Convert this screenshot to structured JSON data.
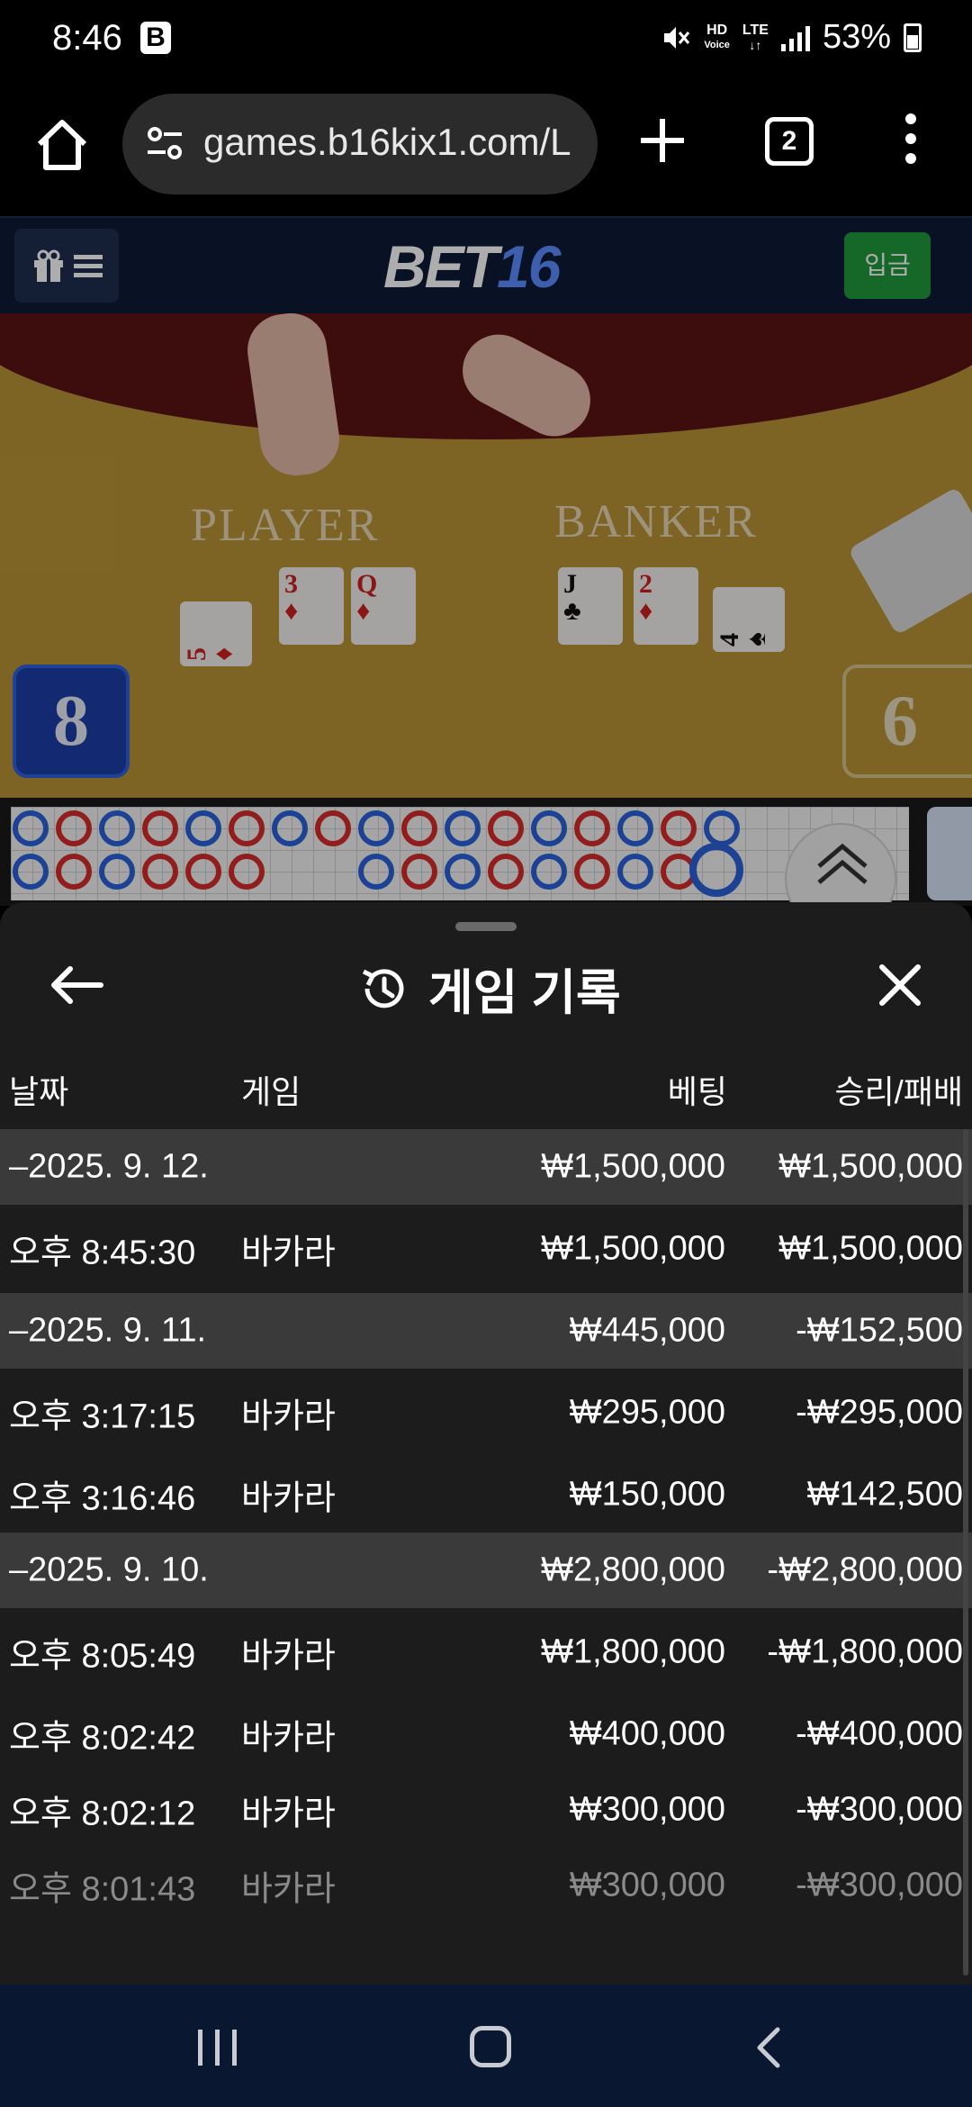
{
  "status_bar": {
    "time": "8:46",
    "app_badge": "B",
    "net_hd": "HD",
    "net_voice": "Voice",
    "net_lte": "LTE",
    "battery": "53%"
  },
  "browser": {
    "url": "games.b16kix1.com/L",
    "tab_count": "2"
  },
  "site": {
    "logo_text": "BET",
    "logo_num": "16",
    "deposit_label": "입금"
  },
  "game_view": {
    "player_label": "PLAYER",
    "banker_label": "BANKER",
    "player_score": "8",
    "banker_score": "6",
    "player_cards": [
      {
        "rank": "5",
        "suit": "♦",
        "color": "red"
      },
      {
        "rank": "3",
        "suit": "♦",
        "color": "red"
      },
      {
        "rank": "Q",
        "suit": "♦",
        "color": "red"
      }
    ],
    "banker_cards": [
      {
        "rank": "J",
        "suit": "♣",
        "color": "black"
      },
      {
        "rank": "2",
        "suit": "♦",
        "color": "red"
      },
      {
        "rank": "4",
        "suit": "♠",
        "color": "black"
      }
    ]
  },
  "sheet": {
    "title": "게임 기록",
    "columns": {
      "date": "날짜",
      "game": "게임",
      "bet": "베팅",
      "win_loss": "승리/패배"
    },
    "rows": [
      {
        "type": "group",
        "date": "–2025. 9. 12.",
        "game": "",
        "bet": "₩1,500,000",
        "result": "₩1,500,000"
      },
      {
        "type": "item",
        "date": "오후 8:45:30",
        "game": "바카라",
        "bet": "₩1,500,000",
        "result": "₩1,500,000"
      },
      {
        "type": "group",
        "date": "–2025. 9. 11.",
        "game": "",
        "bet": "₩445,000",
        "result": "-₩152,500"
      },
      {
        "type": "item",
        "date": "오후 3:17:15",
        "game": "바카라",
        "bet": "₩295,000",
        "result": "-₩295,000"
      },
      {
        "type": "item",
        "date": "오후 3:16:46",
        "game": "바카라",
        "bet": "₩150,000",
        "result": "₩142,500"
      },
      {
        "type": "group",
        "date": "–2025. 9. 10.",
        "game": "",
        "bet": "₩2,800,000",
        "result": "-₩2,800,000"
      },
      {
        "type": "item",
        "date": "오후 8:05:49",
        "game": "바카라",
        "bet": "₩1,800,000",
        "result": "-₩1,800,000"
      },
      {
        "type": "item",
        "date": "오후 8:02:42",
        "game": "바카라",
        "bet": "₩400,000",
        "result": "-₩400,000"
      },
      {
        "type": "item",
        "date": "오후 8:02:12",
        "game": "바카라",
        "bet": "₩300,000",
        "result": "-₩300,000"
      },
      {
        "type": "item",
        "date": "오후 8:01:43",
        "game": "바카라",
        "bet": "₩300,000",
        "result": "-₩300,000",
        "faded": true
      }
    ]
  },
  "colors": {
    "sheet_bg": "#1c1c1c",
    "group_row_bg": "#3a3a3a",
    "deposit_green": "#1f9a3a",
    "header_navy": "#0d1b36",
    "player_blue": "#1d3fa8"
  }
}
